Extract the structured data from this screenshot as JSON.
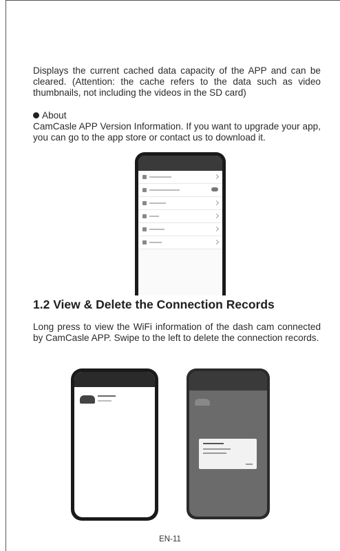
{
  "cache_paragraph": "Displays the current cached data capacity of the APP and can be cleared. (Attention: the cache refers to the data such as video thumbnails, not including the videos in the SD card)",
  "about_bullet": "About",
  "about_paragraph": "CamCasle APP Version Information. If you want to upgrade your app, you can go to the app store or contact us to download it.",
  "section_heading": "1.2 View & Delete the Connection Records",
  "section_paragraph": "Long press to view the WiFi information of the dash cam connected by CamCasle APP.  Swipe to the left to delete the connection records.",
  "page_number": "EN-11"
}
